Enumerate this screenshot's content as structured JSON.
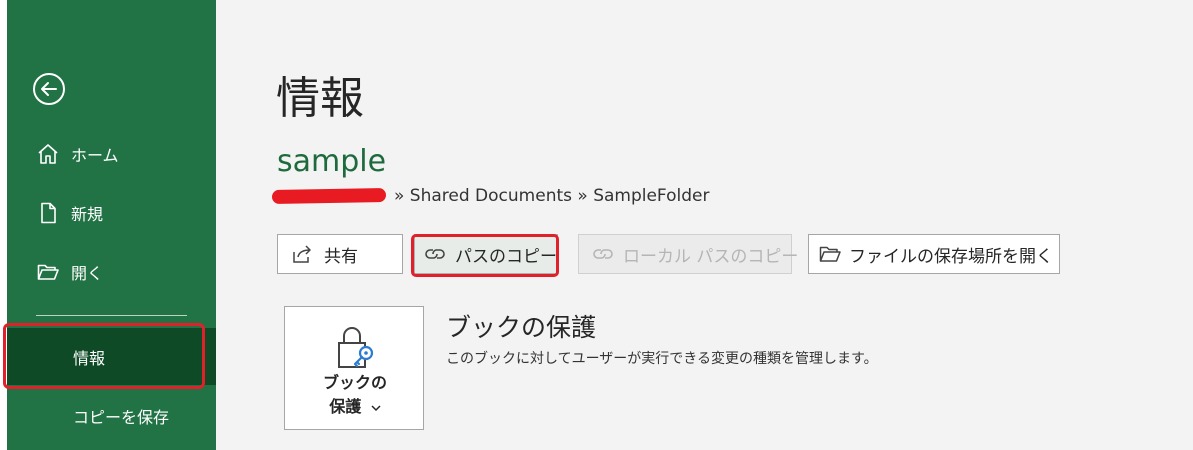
{
  "sidebar": {
    "back_icon": "back-arrow-circle-icon",
    "items": [
      {
        "label": "ホーム",
        "icon": "home-icon"
      },
      {
        "label": "新規",
        "icon": "new-document-icon"
      },
      {
        "label": "開く",
        "icon": "folder-open-icon"
      },
      {
        "label": "情報",
        "active": true
      },
      {
        "label": "コピーを保存"
      }
    ],
    "bg_color": "#217346",
    "active_color": "#0e4a26"
  },
  "main": {
    "title": "情報",
    "document_name": "sample",
    "breadcrumb": "» Shared Documents » SampleFolder",
    "buttons": {
      "share": {
        "label": "共有",
        "icon": "share-icon"
      },
      "copy_path": {
        "label": "パスのコピー",
        "icon": "link-icon"
      },
      "copy_local_path": {
        "label": "ローカル パスのコピー",
        "icon": "link-icon",
        "disabled": true
      },
      "open_location": {
        "label": "ファイルの保存場所を開く",
        "icon": "folder-open-icon"
      }
    },
    "protect": {
      "tile_label_line1": "ブックの",
      "tile_label_line2": "保護",
      "tile_icon": "lock-key-icon",
      "title": "ブックの保護",
      "description": "このブックに対してユーザーが実行できる変更の種類を管理します。"
    }
  },
  "colors": {
    "accent": "#217346",
    "annotation": "#e0202a"
  }
}
